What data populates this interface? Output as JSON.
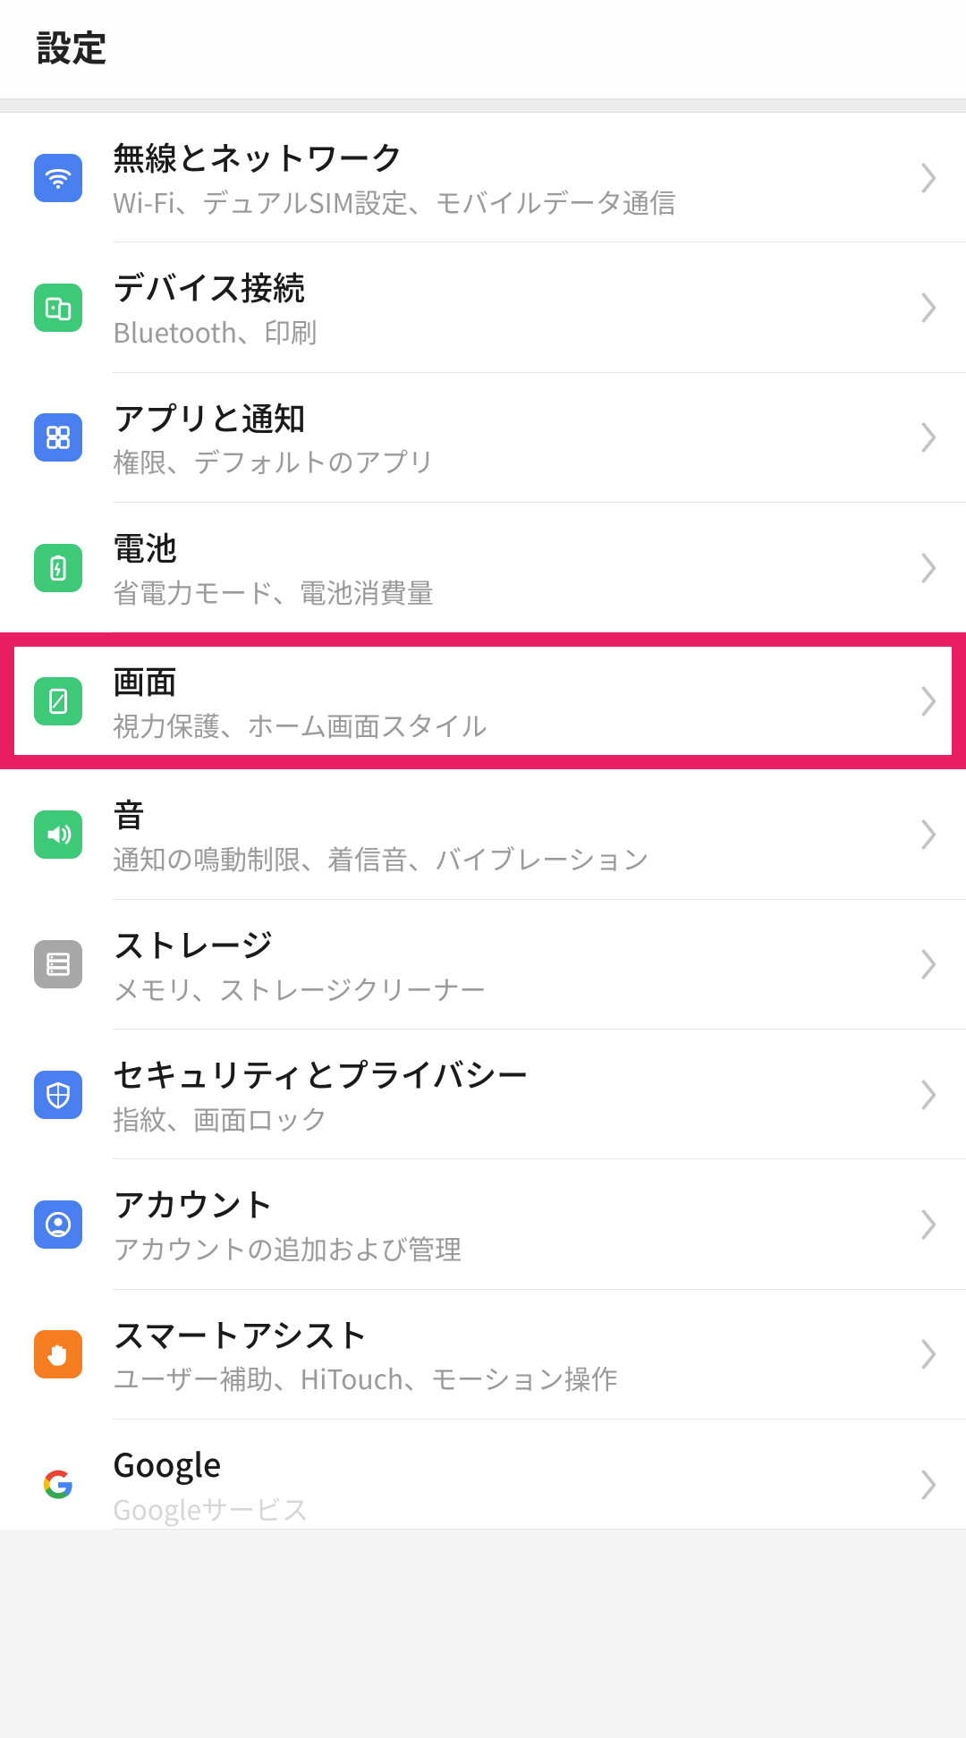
{
  "header": {
    "title": "設定"
  },
  "rows": [
    {
      "title": "無線とネットワーク",
      "sub": "Wi-Fi、デュアルSIM設定、モバイルデータ通信"
    },
    {
      "title": "デバイス接続",
      "sub": "Bluetooth、印刷"
    },
    {
      "title": "アプリと通知",
      "sub": "権限、デフォルトのアプリ"
    },
    {
      "title": "電池",
      "sub": "省電力モード、電池消費量"
    },
    {
      "title": "画面",
      "sub": "視力保護、ホーム画面スタイル"
    },
    {
      "title": "音",
      "sub": "通知の鳴動制限、着信音、バイブレーション"
    },
    {
      "title": "ストレージ",
      "sub": "メモリ、ストレージクリーナー"
    },
    {
      "title": "セキュリティとプライバシー",
      "sub": "指紋、画面ロック"
    },
    {
      "title": "アカウント",
      "sub": "アカウントの追加および管理"
    },
    {
      "title": "スマートアシスト",
      "sub": "ユーザー補助、HiTouch、モーション操作"
    },
    {
      "title": "Google",
      "sub": "Googleサービス"
    }
  ],
  "highlight_index": 4,
  "colors": {
    "highlight": "#e91e63",
    "blue": "#4a7ff0",
    "green": "#3dc978",
    "gray": "#a7a7a7",
    "orange": "#f57c1f"
  }
}
